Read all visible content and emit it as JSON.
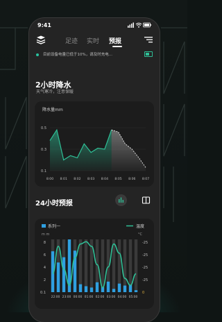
{
  "status_bar": {
    "time": "9:41"
  },
  "nav": {
    "tabs": [
      {
        "label": "足迹",
        "active": false
      },
      {
        "label": "实时",
        "active": false
      },
      {
        "label": "预报",
        "active": true
      }
    ]
  },
  "notice": {
    "text": "目前设备电量已低于10%，请及时充电..."
  },
  "rain_section": {
    "title": "2小时降水",
    "subtitle": "天气寒冷，注意保暖",
    "chart_data": {
      "type": "area",
      "ylabel": "降水量mm",
      "y_ticks": [
        "0.5",
        "0.3",
        "0.1"
      ],
      "ylim": [
        0.1,
        0.5
      ],
      "categories": [
        "8:00",
        "8:01",
        "8:02",
        "8:03",
        "8:04",
        "8:05",
        "8:06",
        "8:07"
      ],
      "x": [
        0,
        0.5,
        1,
        1.5,
        2,
        2.5,
        3,
        3.5,
        4,
        4.5,
        5,
        5.5,
        6,
        6.5,
        7
      ],
      "values": [
        0.38,
        0.48,
        0.2,
        0.24,
        0.22,
        0.35,
        0.27,
        0.31,
        0.3,
        0.48,
        0.46,
        0.35,
        0.3,
        0.22,
        0.13
      ],
      "forecast_from_index": 9,
      "colors": {
        "solid": "#2fbf96",
        "forecast": "#dddddd"
      }
    }
  },
  "forecast_section": {
    "title": "24小时预报",
    "chart_data": {
      "type": "bar",
      "legend": [
        {
          "name": "系列一"
        },
        {
          "name": "温度"
        }
      ],
      "left_unit": "m m",
      "right_unit": "°C",
      "left_ticks": [
        "8",
        "6",
        "4",
        "2",
        "0.1"
      ],
      "right_ticks": [
        "-25",
        "-25",
        "-25",
        "-25",
        "0"
      ],
      "categories": [
        "22:00",
        "23:00",
        "00:00",
        "01:00",
        "02:00",
        "03:00",
        "04:00",
        "05:00"
      ],
      "series": [
        {
          "name": "系列一",
          "values": [
            6.2,
            4.5,
            5.3,
            8.0,
            6.3,
            1.2,
            0.9,
            0.7,
            1.5,
            0.8,
            1.6,
            0.5,
            1.3,
            1.0,
            1.1,
            0.3
          ]
        },
        {
          "name": "温度",
          "values": [
            -20,
            -8,
            -18,
            -25,
            -13,
            -7,
            -6,
            -8,
            -16,
            -26,
            -17,
            -7,
            -11,
            -22,
            -25,
            -20
          ]
        }
      ],
      "colors": {
        "bar": "#2f9fe0",
        "bar_bg": "#3a3a3a",
        "line": "#2fbf96"
      }
    }
  }
}
